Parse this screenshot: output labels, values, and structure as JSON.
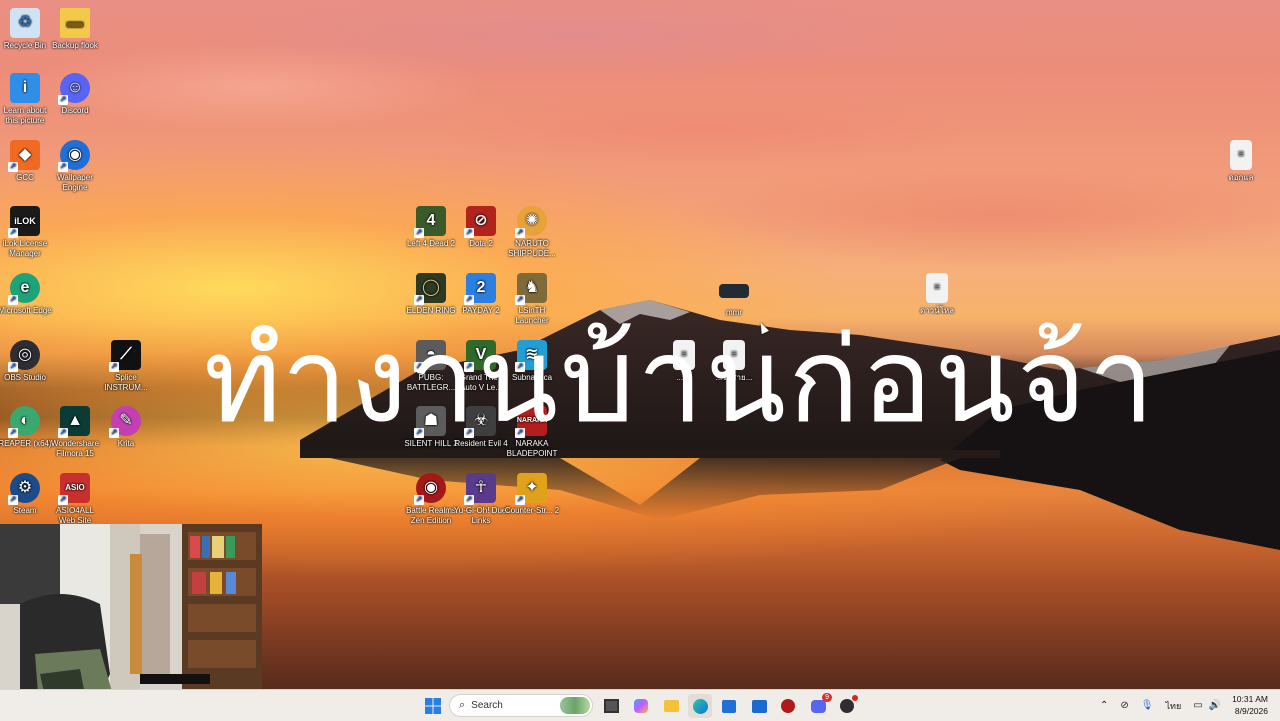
{
  "desktop": {
    "overlay_text": "ทำงานบ้านก่อนจ้า",
    "icons": [
      {
        "label": "Recycle Bin",
        "icon": "recycle-bin-icon",
        "color": "#cfe3f5"
      },
      {
        "label": "Backup flook",
        "icon": "folder-icon",
        "color": "#f3c94a"
      },
      {
        "label": "Learn about this picture",
        "icon": "info-icon",
        "color": "#2f8fe8"
      },
      {
        "label": "Discord",
        "icon": "discord-icon",
        "color": "#5865f2"
      },
      {
        "label": "GCC",
        "icon": "gcc-icon",
        "color": "#f06a24"
      },
      {
        "label": "Wallpaper Engine",
        "icon": "wallpaper-engine-icon",
        "color": "#1f6fd6"
      },
      {
        "label": "iLok License Manager",
        "icon": "ilok-icon",
        "color": "#1a1a1a"
      },
      {
        "label": "Microsoft Edge",
        "icon": "edge-icon",
        "color": "#1ea27a"
      },
      {
        "label": "OBS Studio",
        "icon": "obs-icon",
        "color": "#2d2d33"
      },
      {
        "label": "Splice INSTRUM...",
        "icon": "splice-icon",
        "color": "#111"
      },
      {
        "label": "REAPER (x64)",
        "icon": "reaper-icon",
        "color": "#3aa86f"
      },
      {
        "label": "Wondershare Filmora 15",
        "icon": "filmora-icon",
        "color": "#0b3b36"
      },
      {
        "label": "Krita",
        "icon": "krita-icon",
        "color": "#c43fb4"
      },
      {
        "label": "Steam",
        "icon": "steam-icon",
        "color": "#1b4b8a"
      },
      {
        "label": "ASIO4ALL Web Site",
        "icon": "asio4all-icon",
        "color": "#c8302d"
      },
      {
        "label": "Left 4 Dead 2",
        "icon": "left4dead2-icon",
        "color": "#3a5a2a"
      },
      {
        "label": "Dota 2",
        "icon": "dota2-icon",
        "color": "#b1241d"
      },
      {
        "label": "NARUTO SHIPPUDE...",
        "icon": "naruto-icon",
        "color": "#e7a33a"
      },
      {
        "label": "ELDEN RING",
        "icon": "elden-ring-icon",
        "color": "#2c3a22"
      },
      {
        "label": "PAYDAY 2",
        "icon": "payday2-icon",
        "color": "#2b7fe0"
      },
      {
        "label": "LSinTH Launcher",
        "icon": "lsinth-icon",
        "color": "#7f6a3a"
      },
      {
        "label": "mmr",
        "icon": "file-icon",
        "color": "#222a33"
      },
      {
        "label": "ดาวน์โหล",
        "icon": "document-icon",
        "color": "#f2f2f2"
      },
      {
        "label": "PUBG: BATTLEGR...",
        "icon": "pubg-icon",
        "color": "#5b5b5b"
      },
      {
        "label": "Grand Theft Auto V Le...",
        "icon": "gta5-icon",
        "color": "#2f6a2a"
      },
      {
        "label": "Subnautica",
        "icon": "subnautica-icon",
        "color": "#1f9fd6"
      },
      {
        "label": "...ลง",
        "icon": "document-icon",
        "color": "#f2f2f2"
      },
      {
        "label": "...รบสาย...",
        "icon": "document-icon",
        "color": "#f2f2f2"
      },
      {
        "label": "SILENT HILL 2",
        "icon": "silent-hill-icon",
        "color": "#5c5c5c"
      },
      {
        "label": "Resident Evil 4",
        "icon": "resident-evil-icon",
        "color": "#3f3f3f"
      },
      {
        "label": "NARAKA BLADEPOINT",
        "icon": "naraka-icon",
        "color": "#b41e1e"
      },
      {
        "label": "Battle Realms Zen Edition",
        "icon": "battle-realms-icon",
        "color": "#a41818"
      },
      {
        "label": "Yu-Gi-Oh! Duel Links",
        "icon": "yugioh-icon",
        "color": "#5a3a8a"
      },
      {
        "label": "Counter-Str... 2",
        "icon": "cs2-icon",
        "color": "#e0a21a"
      },
      {
        "label": "ดอกแล",
        "icon": "document-icon",
        "color": "#f2f2f2"
      }
    ]
  },
  "taskbar": {
    "start_icon": "windows-start-icon",
    "search_placeholder": "Search",
    "apps": [
      "task-view-icon",
      "copilot-icon",
      "file-explorer-icon",
      "edge-icon",
      "store-icon",
      "outlook-icon",
      "record-icon",
      "discord-icon",
      "obs-icon"
    ],
    "discord_badge": "9",
    "tray": {
      "language": "ไทย",
      "time": "10:31 AM",
      "date": "8/9/2026"
    }
  }
}
